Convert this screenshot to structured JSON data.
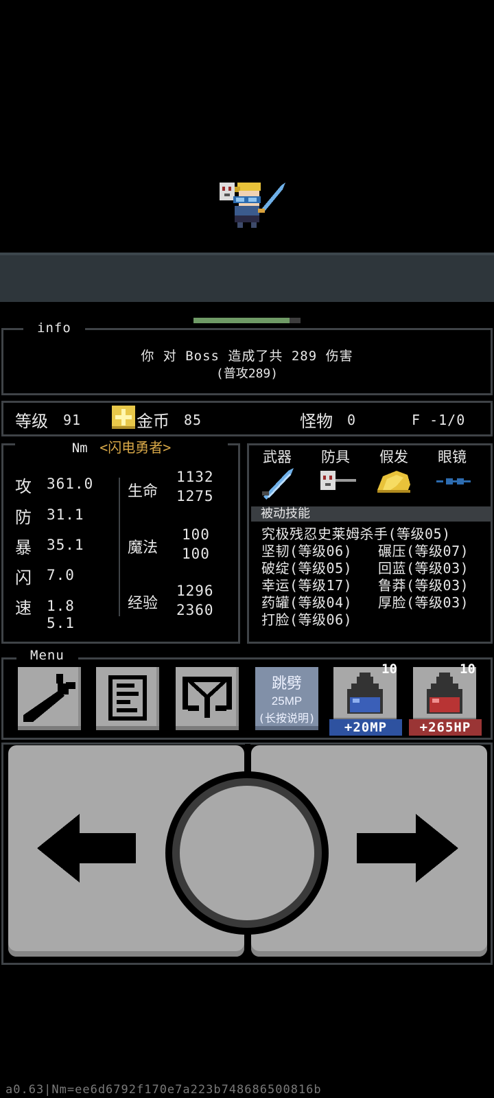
{
  "info": {
    "title": "info",
    "damage_line": "你 对 Boss 造成了共 289 伤害",
    "detail_line": "(普攻289)"
  },
  "boss_hp_fraction": 0.9,
  "status": {
    "level_label": "等级",
    "level_value": "91",
    "gold_label": "金币",
    "gold_value": "85",
    "monster_label": "怪物",
    "monster_value": "0",
    "floor_text": "F -1/0"
  },
  "character": {
    "name": "Nm",
    "title": "<闪电勇者>",
    "stats": [
      {
        "label": "攻",
        "value": "361.0"
      },
      {
        "label": "防",
        "value": "31.1"
      },
      {
        "label": "暴",
        "value": "35.1"
      },
      {
        "label": "闪",
        "value": "7.0"
      },
      {
        "label": "速",
        "value": "1.8",
        "value2": "5.1"
      }
    ],
    "hp": {
      "label": "生命",
      "current": "1132",
      "max": "1275"
    },
    "mp": {
      "label": "魔法",
      "current": "100",
      "max": "100"
    },
    "exp": {
      "label": "经验",
      "current": "1296",
      "max": "2360"
    }
  },
  "equipment": {
    "slots": [
      {
        "label": "武器",
        "icon": "sword-icon"
      },
      {
        "label": "防具",
        "icon": "mask-armor-icon"
      },
      {
        "label": "假发",
        "icon": "wig-icon"
      },
      {
        "label": "眼镜",
        "icon": "glasses-icon"
      }
    ],
    "passive_title": "被动技能",
    "skills": [
      "究极残忍史莱姆杀手(等级05)",
      "坚韧(等级06)",
      "碾压(等级07)",
      "破绽(等级05)",
      "回蓝(等级03)",
      "幸运(等级17)",
      "鲁莽(等级03)",
      "药罐(等级04)",
      "厚脸(等级03)",
      "打脸(等级06)"
    ]
  },
  "menu": {
    "title": "Menu",
    "skill_button": {
      "name": "跳劈",
      "cost": "25MP",
      "hint": "(长按说明)"
    },
    "mp_potion": {
      "count": "10",
      "label": "+20MP"
    },
    "hp_potion": {
      "count": "10",
      "label": "+265HP"
    }
  },
  "footer": "a0.63|Nm=ee6d6792f170e7a223b748686500816b",
  "colors": {
    "gold": "#e8c84a",
    "title_gold": "#d8a848",
    "mp_blue": "#2e52a0",
    "hp_red": "#9a3535",
    "panel_border": "#3f4347"
  }
}
